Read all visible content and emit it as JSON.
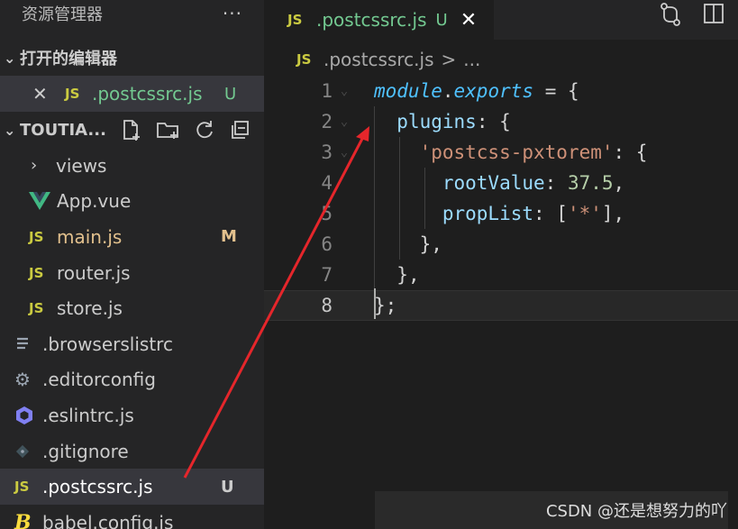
{
  "explorer": {
    "title": "资源管理器",
    "more": "···"
  },
  "open_editors": {
    "section_label": "打开的编辑器",
    "items": [
      {
        "icon": "JS",
        "name": ".postcssrc.js",
        "badge": "U"
      }
    ]
  },
  "project": {
    "name": "TOUTIA...",
    "actions": [
      "new-file",
      "new-folder",
      "refresh",
      "collapse-all"
    ]
  },
  "tree": [
    {
      "name": "views",
      "icon": "chevron-right",
      "badge": "",
      "level": 1,
      "status": ""
    },
    {
      "name": "App.vue",
      "icon": "vue",
      "badge": "",
      "level": 1,
      "status": ""
    },
    {
      "name": "main.js",
      "icon": "JS",
      "badge": "M",
      "level": 1,
      "status": "modified"
    },
    {
      "name": "router.js",
      "icon": "JS",
      "badge": "",
      "level": 1,
      "status": ""
    },
    {
      "name": "store.js",
      "icon": "JS",
      "badge": "",
      "level": 1,
      "status": ""
    },
    {
      "name": ".browserslistrc",
      "icon": "lines",
      "badge": "",
      "level": 0,
      "status": ""
    },
    {
      "name": ".editorconfig",
      "icon": "gear",
      "badge": "",
      "level": 0,
      "status": ""
    },
    {
      "name": ".eslintrc.js",
      "icon": "eslint",
      "badge": "",
      "level": 0,
      "status": ""
    },
    {
      "name": ".gitignore",
      "icon": "git",
      "badge": "",
      "level": 0,
      "status": ""
    },
    {
      "name": ".postcssrc.js",
      "icon": "JS",
      "badge": "U",
      "level": 0,
      "status": "selected"
    },
    {
      "name": "babel.config.js",
      "icon": "babel",
      "badge": "",
      "level": 0,
      "status": ""
    }
  ],
  "tab": {
    "icon": "JS",
    "name": ".postcssrc.js",
    "badge": "U",
    "close": "✕"
  },
  "breadcrumb": {
    "icon": "JS",
    "file": ".postcssrc.js",
    "sep": ">",
    "rest": "..."
  },
  "code_lines": [
    {
      "n": "1",
      "tokens": [
        [
          "kw",
          "module"
        ],
        [
          "op",
          "."
        ],
        [
          "kw",
          "exports"
        ],
        [
          "op",
          " "
        ],
        [
          "op",
          "= {"
        ]
      ]
    },
    {
      "n": "2",
      "tokens": [
        [
          "op",
          "  "
        ],
        [
          "prop",
          "plugins"
        ],
        [
          "op",
          ": {"
        ]
      ]
    },
    {
      "n": "3",
      "tokens": [
        [
          "op",
          "    "
        ],
        [
          "str",
          "'postcss-pxtorem'"
        ],
        [
          "op",
          ": {"
        ]
      ]
    },
    {
      "n": "4",
      "tokens": [
        [
          "op",
          "      "
        ],
        [
          "prop",
          "rootValue"
        ],
        [
          "op",
          ": "
        ],
        [
          "num",
          "37.5"
        ],
        [
          "op",
          ","
        ]
      ]
    },
    {
      "n": "5",
      "tokens": [
        [
          "op",
          "      "
        ],
        [
          "prop",
          "propList"
        ],
        [
          "op",
          ": ["
        ],
        [
          "str",
          "'*'"
        ],
        [
          "op",
          "],"
        ]
      ]
    },
    {
      "n": "6",
      "tokens": [
        [
          "op",
          "    "
        ],
        [
          "op",
          "},"
        ]
      ]
    },
    {
      "n": "7",
      "tokens": [
        [
          "op",
          "  "
        ],
        [
          "op",
          "},"
        ]
      ]
    },
    {
      "n": "8",
      "tokens": [
        [
          "op",
          "};"
        ]
      ]
    }
  ],
  "current_line": "8",
  "watermark": "CSDN @还是想努力的吖",
  "colors": {
    "annotation_arrow": "#e5262b",
    "untracked": "#73c991",
    "modified": "#e2c08d",
    "js_icon": "#cbcb41"
  }
}
